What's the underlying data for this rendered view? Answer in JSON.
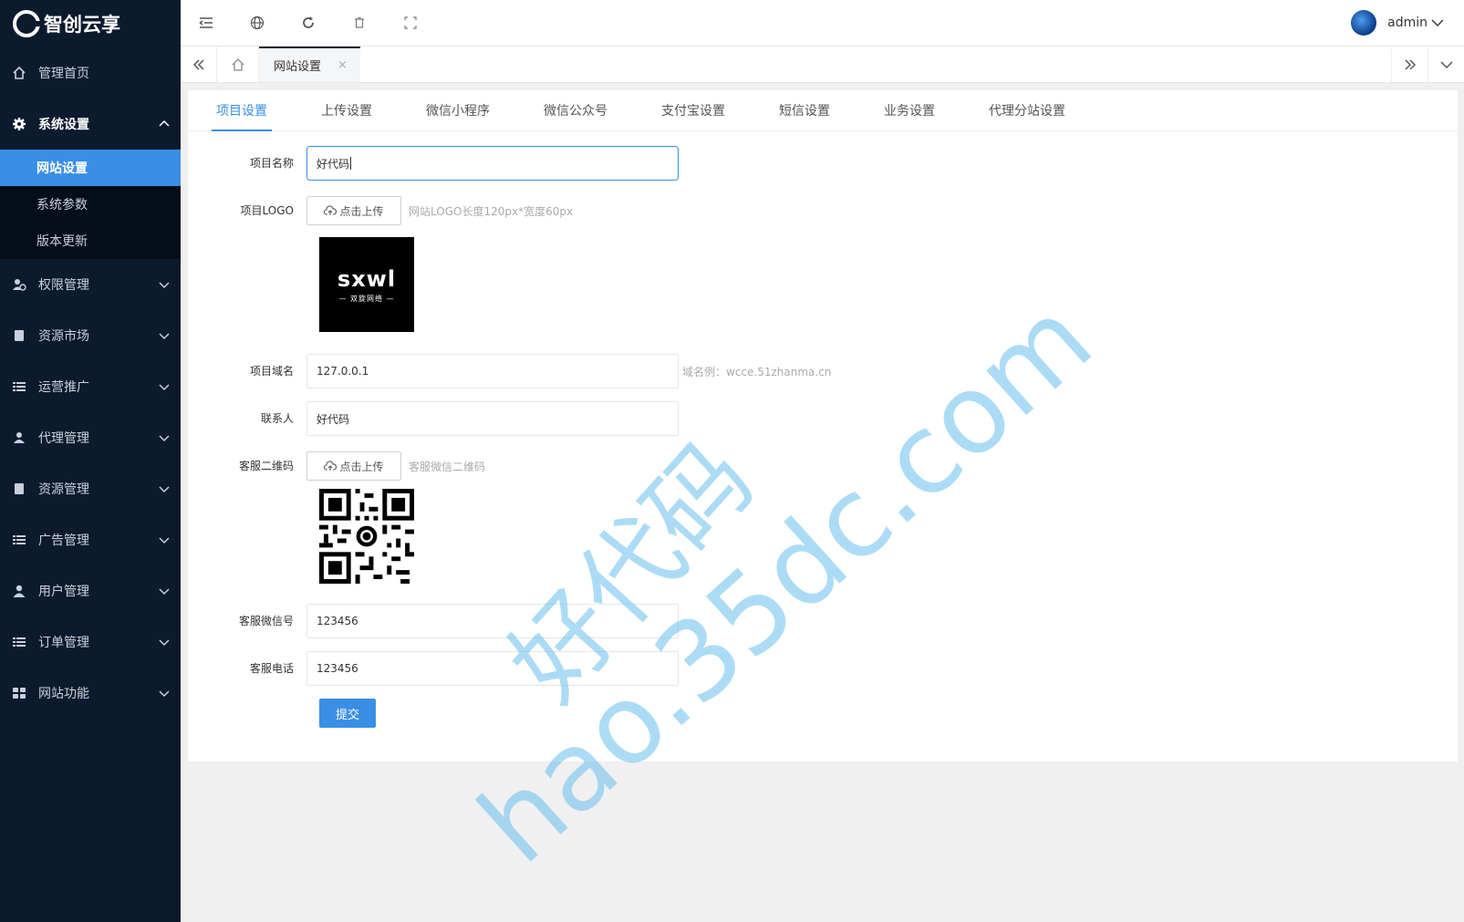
{
  "app": {
    "name": "智创云享"
  },
  "sidebar": {
    "items": [
      {
        "label": "管理首页",
        "icon": "home-icon"
      },
      {
        "label": "系统设置",
        "icon": "gear-icon",
        "open": true,
        "children": [
          {
            "label": "网站设置",
            "active": true
          },
          {
            "label": "系统参数"
          },
          {
            "label": "版本更新"
          }
        ]
      },
      {
        "label": "权限管理",
        "icon": "user-group-icon"
      },
      {
        "label": "资源市场",
        "icon": "book-icon"
      },
      {
        "label": "运营推广",
        "icon": "list-icon"
      },
      {
        "label": "代理管理",
        "icon": "user-group-icon"
      },
      {
        "label": "资源管理",
        "icon": "book-icon"
      },
      {
        "label": "广告管理",
        "icon": "list-icon"
      },
      {
        "label": "用户管理",
        "icon": "user-icon"
      },
      {
        "label": "订单管理",
        "icon": "list-icon"
      },
      {
        "label": "网站功能",
        "icon": "grid-icon"
      }
    ]
  },
  "topbar": {
    "icons": [
      "collapse-menu-icon",
      "globe-icon",
      "refresh-icon",
      "trash-icon",
      "fullscreen-icon"
    ],
    "user": "admin"
  },
  "tabs": {
    "current": "网站设置",
    "close": "×"
  },
  "subtabs": [
    "项目设置",
    "上传设置",
    "微信小程序",
    "微信公众号",
    "支付宝设置",
    "短信设置",
    "业务设置",
    "代理分站设置"
  ],
  "form": {
    "project_name": {
      "label": "项目名称",
      "value": "好代码"
    },
    "project_logo": {
      "label": "项目LOGO",
      "button": "点击上传",
      "hint": "网站LOGO长度120px*宽度60px",
      "logo_text": "sxwl",
      "logo_sub": "— 双旋网络 —"
    },
    "domain": {
      "label": "项目域名",
      "value": "127.0.0.1",
      "hint": "域名例：wcce.51zhanma.cn"
    },
    "contact": {
      "label": "联系人",
      "value": "好代码"
    },
    "qrcode": {
      "label": "客服二维码",
      "button": "点击上传",
      "hint": "客服微信二维码"
    },
    "wechat": {
      "label": "客服微信号",
      "value": "123456"
    },
    "phone": {
      "label": "客服电话",
      "value": "123456"
    },
    "submit": "提交"
  },
  "watermark": {
    "line1": "好代码",
    "line2": "hao.35dc.com"
  },
  "colors": {
    "sidebar_bg": "#0c1a2e",
    "accent": "#3a8ee6"
  }
}
